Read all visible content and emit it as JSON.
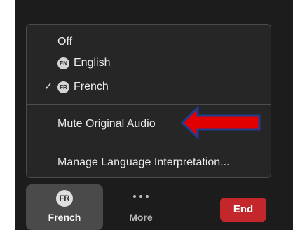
{
  "language_menu": {
    "items": [
      {
        "label": "Off",
        "badge": "",
        "checked": false
      },
      {
        "label": "English",
        "badge": "EN",
        "checked": false
      },
      {
        "label": "French",
        "badge": "FR",
        "checked": true
      }
    ],
    "check_glyph": "✓",
    "mute_original_audio": "Mute Original Audio",
    "manage_language_interpretation": "Manage Language Interpretation..."
  },
  "toolbar": {
    "language_button": {
      "avatar": "FR",
      "label": "French"
    },
    "more_button": {
      "label": "More",
      "icon": "more-dots-icon"
    },
    "end_button": {
      "label": "End"
    }
  },
  "colors": {
    "menu_background": "#262626",
    "toolbar_background": "#1c1c1c",
    "end_button": "#c3272b",
    "annotation_arrow": "#e00000",
    "annotation_arrow_outline": "#1f3c8f"
  }
}
